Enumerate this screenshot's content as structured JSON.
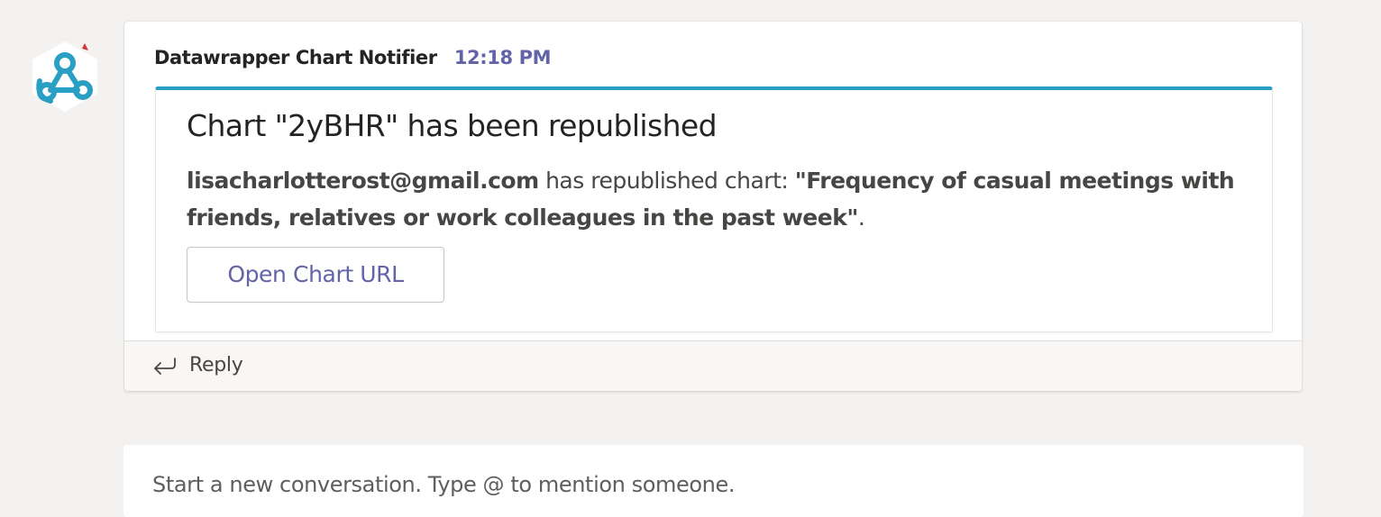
{
  "message": {
    "sender": "Datawrapper Chart Notifier",
    "timestamp": "12:18 PM",
    "avatar_icon": "webhook-icon",
    "card": {
      "accent_color": "#2a9fc4",
      "title": "Chart \"2yBHR\" has been republished",
      "body": {
        "user": "lisacharlotterost@gmail.com",
        "action": " has republished chart: ",
        "chart_title": "\"Frequency of casual meetings with friends, relatives or work colleagues in the past week\"",
        "suffix": "."
      },
      "button_label": "Open Chart URL"
    },
    "reply": {
      "icon": "reply-arrow-icon",
      "label": "Reply"
    }
  },
  "compose": {
    "placeholder": "Start a new conversation. Type @ to mention someone."
  },
  "colors": {
    "accent": "#6264a7",
    "background": "#f3f2f1"
  }
}
